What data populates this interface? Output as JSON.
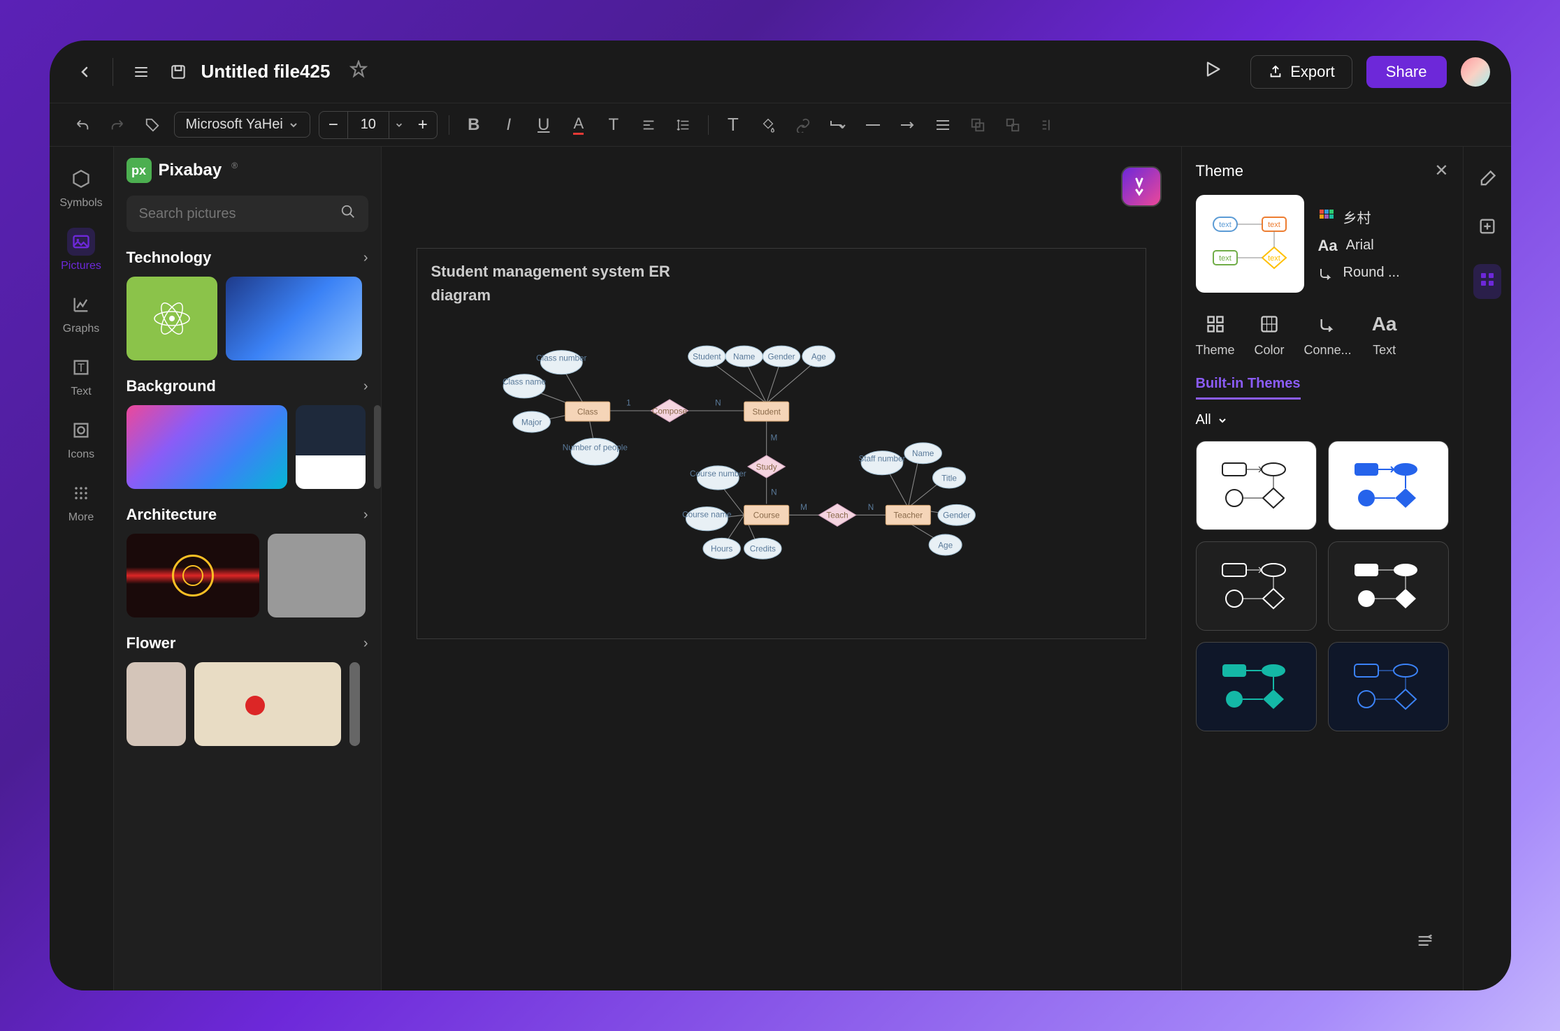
{
  "header": {
    "file_title": "Untitled file425",
    "export_label": "Export",
    "share_label": "Share"
  },
  "toolbar": {
    "font_name": "Microsoft YaHei",
    "font_size": "10"
  },
  "leftnav": {
    "symbols": "Symbols",
    "pictures": "Pictures",
    "graphs": "Graphs",
    "text": "Text",
    "icons": "Icons",
    "more": "More"
  },
  "sidebar": {
    "brand": "Pixabay",
    "search_placeholder": "Search pictures",
    "categories": {
      "technology": "Technology",
      "background": "Background",
      "architecture": "Architecture",
      "flower": "Flower"
    }
  },
  "canvas": {
    "title_line1": "Student management system ER",
    "title_line2": "diagram",
    "entities": {
      "class": "Class",
      "student": "Student",
      "course": "Course",
      "teacher": "Teacher"
    },
    "relationships": {
      "compose": "Compose",
      "study": "Study",
      "teach": "Teach"
    },
    "attributes": {
      "class_number": "Class number",
      "class_name": "Class name",
      "major": "Major",
      "number_of_people": "Number of people",
      "student_name_attr": "Student",
      "name": "Name",
      "gender": "Gender",
      "age": "Age",
      "course_number": "Course number",
      "course_name": "Course name",
      "hours": "Hours",
      "credits": "Credits",
      "staff_number": "Staff number",
      "title": "Title",
      "age2": "Age"
    },
    "cardinality": {
      "one": "1",
      "n": "N",
      "m": "M"
    }
  },
  "theme_panel": {
    "title": "Theme",
    "style_name": "乡村",
    "font_name": "Arial",
    "connector": "Round ...",
    "tabs": {
      "theme": "Theme",
      "color": "Color",
      "connector": "Conne...",
      "text": "Text"
    },
    "builtin": "Built-in Themes",
    "filter_all": "All"
  },
  "theme_preview_nodes": {
    "text": "text"
  }
}
